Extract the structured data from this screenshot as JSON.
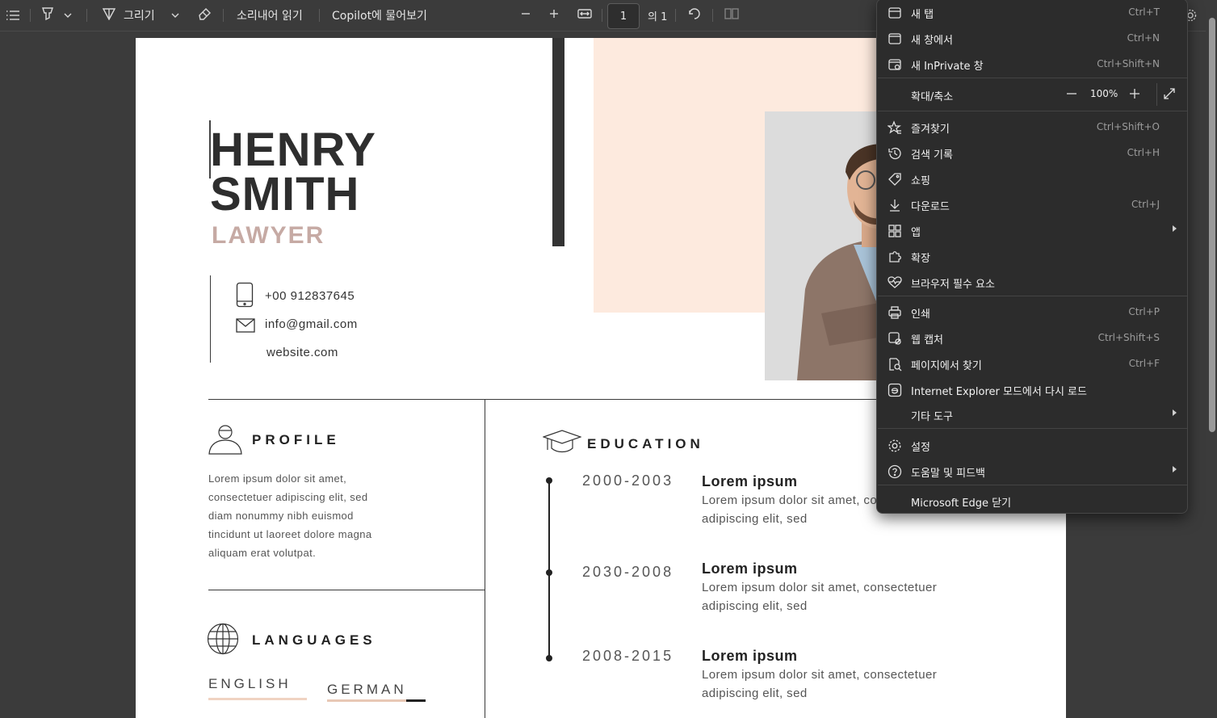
{
  "toolbar": {
    "draw_label": "그리기",
    "read_aloud": "소리내어 읽기",
    "copilot": "Copilot에 물어보기",
    "page_current": "1",
    "page_total": "의 1"
  },
  "resume": {
    "first_name": "HENRY",
    "last_name": "SMITH",
    "role": "LAWYER",
    "phone": "+00 912837645",
    "email": "info@gmail.com",
    "website": "website.com",
    "profile_title": "PROFILE",
    "profile_text": [
      "Lorem ipsum dolor sit amet,",
      "consectetuer adipiscing elit, sed",
      "diam nonummy nibh euismod",
      "tincidunt ut laoreet dolore magna",
      "aliquam erat volutpat."
    ],
    "languages_title": "LANGUAGES",
    "languages": [
      {
        "name": "ENGLISH",
        "level": 1.0
      },
      {
        "name": "GERMAN",
        "level": 0.8
      }
    ],
    "education_title": "EDUCATION",
    "education": [
      {
        "years": "2000-2003",
        "title": "Lorem ipsum",
        "line1": "Lorem ipsum dolor sit amet, consectetuer",
        "line2": "adipiscing elit, sed"
      },
      {
        "years": "2030-2008",
        "title": "Lorem ipsum",
        "line1": "Lorem ipsum dolor sit amet, consectetuer",
        "line2": "adipiscing elit, sed"
      },
      {
        "years": "2008-2015",
        "title": "Lorem ipsum",
        "line1": "Lorem ipsum dolor sit amet, consectetuer",
        "line2": "adipiscing elit, sed"
      }
    ]
  },
  "menu": {
    "items": [
      {
        "label": "새 탭",
        "shortcut": "Ctrl+T",
        "icon": "new-tab-icon"
      },
      {
        "label": "새 창에서",
        "shortcut": "Ctrl+N",
        "icon": "new-window-icon"
      },
      {
        "label": "새 InPrivate 창",
        "shortcut": "Ctrl+Shift+N",
        "icon": "inprivate-icon"
      },
      {
        "label": "확대/축소",
        "zoom_value": "100%"
      },
      {
        "label": "즐겨찾기",
        "shortcut": "Ctrl+Shift+O",
        "icon": "favorites-icon"
      },
      {
        "label": "검색 기록",
        "shortcut": "Ctrl+H",
        "icon": "history-icon"
      },
      {
        "label": "쇼핑",
        "shortcut": "",
        "icon": "shopping-tag-icon"
      },
      {
        "label": "다운로드",
        "shortcut": "Ctrl+J",
        "icon": "download-icon"
      },
      {
        "label": "앱",
        "shortcut": "",
        "icon": "apps-icon"
      },
      {
        "label": "확장",
        "shortcut": "",
        "icon": "extensions-icon"
      },
      {
        "label": "브라우저 필수 요소",
        "shortcut": "",
        "icon": "heart-pulse-icon"
      },
      {
        "label": "인쇄",
        "shortcut": "Ctrl+P",
        "icon": "print-icon"
      },
      {
        "label": "웹 캡처",
        "shortcut": "Ctrl+Shift+S",
        "icon": "web-capture-icon"
      },
      {
        "label": "페이지에서 찾기",
        "shortcut": "Ctrl+F",
        "icon": "find-icon"
      },
      {
        "label": "Internet Explorer 모드에서 다시 로드",
        "shortcut": "",
        "icon": "ie-icon"
      },
      {
        "label": "기타 도구",
        "shortcut": ""
      },
      {
        "label": "설정",
        "shortcut": "",
        "icon": "settings-icon"
      },
      {
        "label": "도움말 및 피드백",
        "shortcut": "",
        "icon": "help-icon"
      },
      {
        "label": "Microsoft Edge 닫기",
        "shortcut": ""
      }
    ]
  }
}
